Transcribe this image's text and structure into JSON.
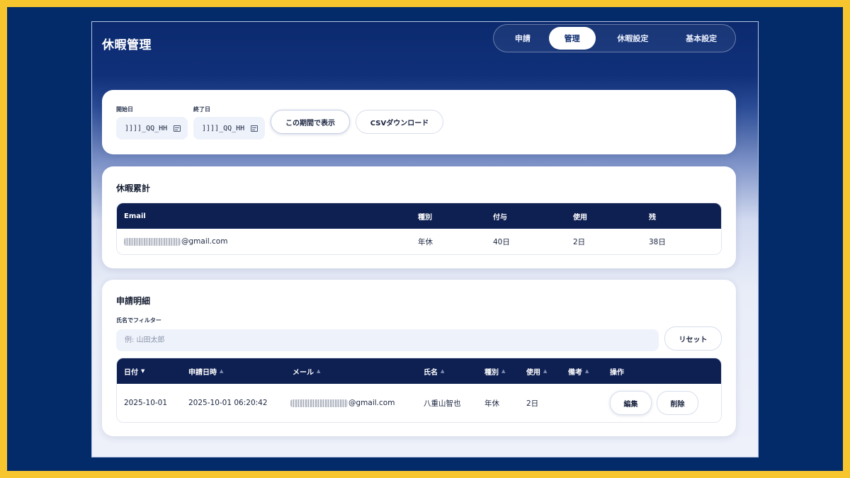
{
  "app": {
    "title": "休暇管理"
  },
  "nav": {
    "tabs": [
      {
        "label": "申請",
        "active": false
      },
      {
        "label": "管理",
        "active": true
      },
      {
        "label": "休暇設定",
        "active": false
      },
      {
        "label": "基本設定",
        "active": false
      }
    ]
  },
  "filter": {
    "start_label": "開始日",
    "start_value": "]]]]_QQ_HH",
    "end_label": "終了日",
    "end_value": "]]]]_QQ_HH",
    "show_button": "この期間で表示",
    "csv_button": "CSVダウンロード"
  },
  "summary": {
    "title": "休暇累計",
    "columns": [
      "Email",
      "種別",
      "付与",
      "使用",
      "残"
    ],
    "rows": [
      {
        "email": "@gmail.com",
        "type": "年休",
        "granted": "40日",
        "used": "2日",
        "remaining": "38日"
      }
    ]
  },
  "detail": {
    "title": "申請明細",
    "filter_label": "氏名でフィルター",
    "filter_placeholder": "例: 山田太郎",
    "reset_button": "リセット",
    "columns": [
      "日付",
      "申請日時",
      "メール",
      "氏名",
      "種別",
      "使用",
      "備考",
      "操作"
    ],
    "rows": [
      {
        "date": "2025-10-01",
        "applied_at": "2025-10-01 06:20:42",
        "email": "@gmail.com",
        "name": "八重山智也",
        "type": "年休",
        "used": "2日",
        "note": "",
        "edit_label": "編集",
        "delete_label": "削除"
      }
    ]
  },
  "colors": {
    "frame": "#f7c62f",
    "background": "#032b69",
    "header": "#0e1f52",
    "accent": "#0b2a6e"
  }
}
